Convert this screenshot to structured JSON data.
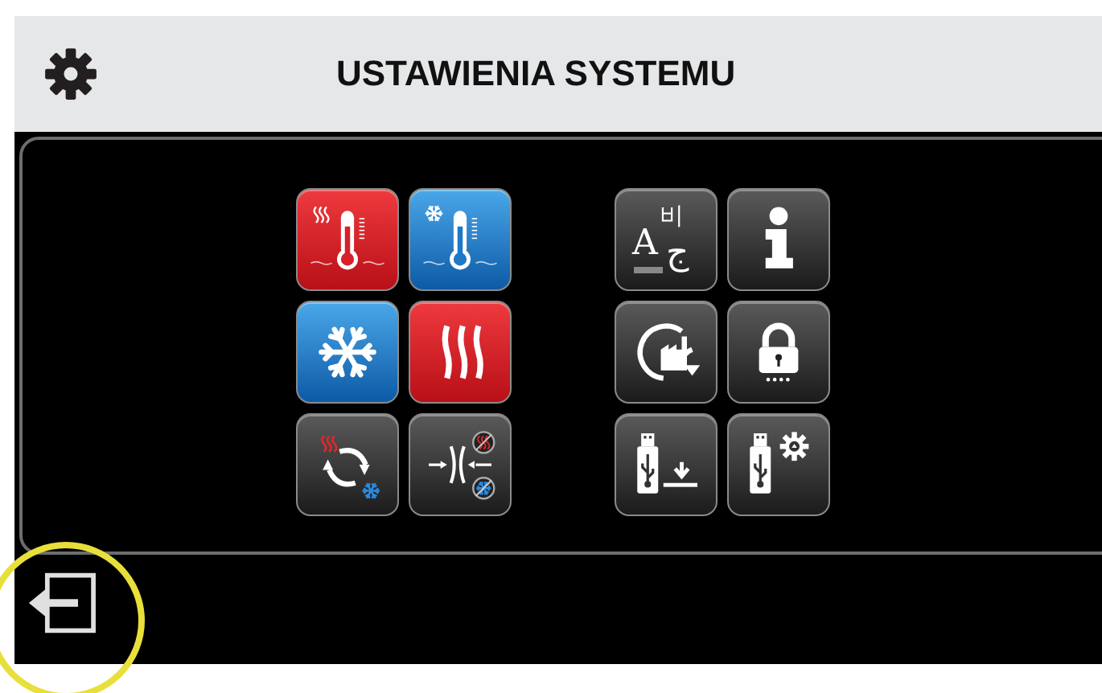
{
  "header": {
    "title": "USTAWIENIA SYSTEMU"
  },
  "groups": [
    {
      "tiles": [
        {
          "kind": "heat-thermometer"
        },
        {
          "kind": "cool-thermometer"
        },
        {
          "kind": "snowflake"
        },
        {
          "kind": "heat-waves"
        },
        {
          "kind": "heat-cool-cycle"
        },
        {
          "kind": "deadband"
        }
      ]
    },
    {
      "tiles": [
        {
          "kind": "language",
          "glyphs": [
            "A",
            "비",
            "ج"
          ]
        },
        {
          "kind": "info"
        },
        {
          "kind": "factory-reset"
        },
        {
          "kind": "lock"
        },
        {
          "kind": "usb-download"
        },
        {
          "kind": "usb-settings"
        }
      ]
    }
  ],
  "footer": {
    "exit": {
      "kind": "exit"
    }
  }
}
